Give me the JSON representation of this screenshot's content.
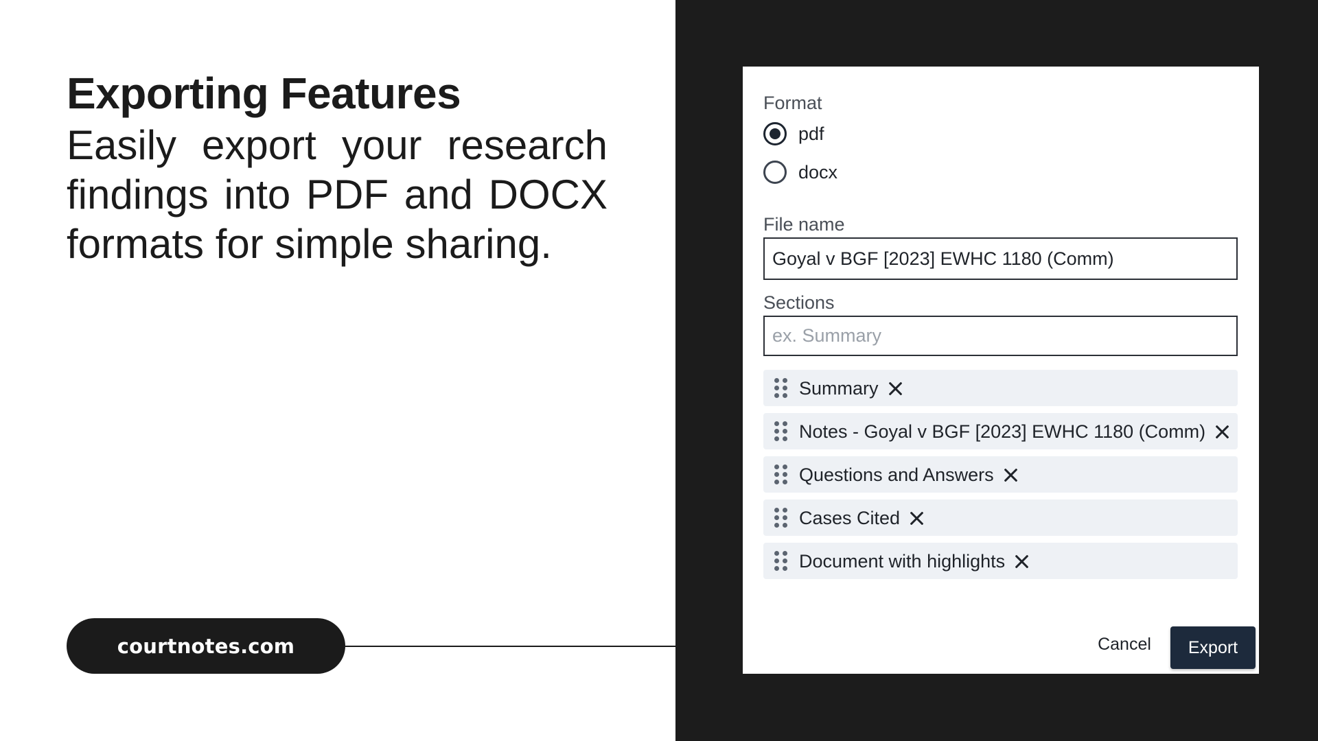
{
  "marketing": {
    "headline": "Exporting Features",
    "subline": "Easily export your research findings into PDF and DOCX formats for simple sharing.",
    "site_pill": "courtnotes.com"
  },
  "dialog": {
    "format_label": "Format",
    "format_options": [
      {
        "label": "pdf",
        "selected": true
      },
      {
        "label": "docx",
        "selected": false
      }
    ],
    "file_name_label": "File name",
    "file_name_value": "Goyal v BGF [2023] EWHC 1180 (Comm)",
    "sections_label": "Sections",
    "sections_placeholder": "ex. Summary",
    "sections": [
      "Summary",
      "Notes - Goyal v BGF [2023] EWHC 1180 (Comm)",
      "Questions and Answers",
      "Cases Cited",
      "Document with highlights"
    ],
    "cancel_label": "Cancel",
    "export_label": "Export"
  },
  "colors": {
    "dark_frame": "#1c1c1c",
    "primary_button": "#1d2a3c",
    "chip_background": "#eef1f5"
  }
}
